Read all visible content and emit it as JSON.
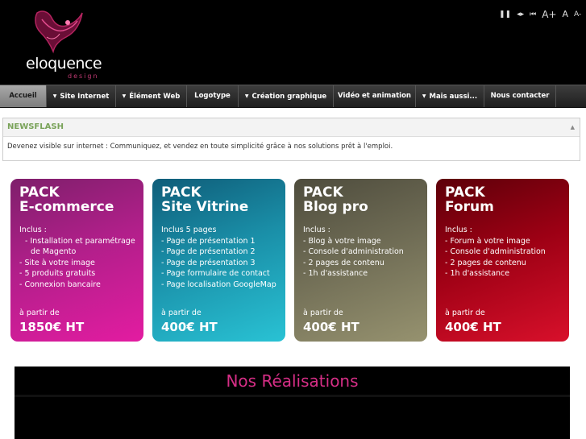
{
  "header": {
    "logo": {
      "name": "eloquence",
      "tagline": "design"
    },
    "controls": [
      {
        "icon": "pause-icon",
        "glyph": "❚❚"
      },
      {
        "icon": "prev-next-icon",
        "glyph": "◂▸"
      },
      {
        "icon": "rewind-icon",
        "glyph": "⏮"
      },
      {
        "label": "A+",
        "size": "big"
      },
      {
        "label": "A",
        "size": "mid"
      },
      {
        "label": "A-",
        "size": "small"
      }
    ]
  },
  "nav": [
    {
      "label": "Accueil",
      "active": true,
      "dropdown": false
    },
    {
      "label": "Site Internet",
      "active": false,
      "dropdown": true
    },
    {
      "label": "Élément Web",
      "active": false,
      "dropdown": true
    },
    {
      "label": "Logotype",
      "active": false,
      "dropdown": false
    },
    {
      "label": "Création graphique",
      "active": false,
      "dropdown": true
    },
    {
      "label": "Vidéo et animation",
      "active": false,
      "dropdown": false
    },
    {
      "label": "Mais aussi...",
      "active": false,
      "dropdown": true
    },
    {
      "label": "Nous contacter",
      "active": false,
      "dropdown": false
    }
  ],
  "newsflash": {
    "title": "NEWSFLASH",
    "text": "Devenez visible sur internet : Communiquez, et vendez en toute simplicité grâce à nos solutions prêt à l'emploi."
  },
  "packs": [
    {
      "title1": "PACK",
      "title2": "E-commerce",
      "incl": "Inclus :",
      "items": [
        "Installation et paramétrage de Magento",
        "Site à votre image",
        "5 produits gratuits",
        "Connexion bancaire"
      ],
      "from": "à partir de",
      "price": "1850€ HT",
      "color": "#c01e92"
    },
    {
      "title1": "PACK",
      "title2": "Site Vitrine",
      "incl": "Inclus 5 pages",
      "items": [
        "Page de présentation 1",
        "Page de présentation 2",
        "Page de présentation 3",
        "Page formulaire de contact",
        "Page localisation GoogleMap"
      ],
      "from": "à partir de",
      "price": "400€ HT",
      "color": "#1a8fa8"
    },
    {
      "title1": "PACK",
      "title2": "Blog pro",
      "incl": "Inclus :",
      "items": [
        "Blog à votre image",
        "Console d'administration",
        "2 pages de contenu",
        "1h d'assistance"
      ],
      "from": "à partir de",
      "price": "400€ HT",
      "color": "#6e6b54"
    },
    {
      "title1": "PACK",
      "title2": "Forum",
      "incl": "Inclus :",
      "items": [
        "Forum à votre image",
        "Console d'administration",
        "2 pages de contenu",
        "1h d'assistance"
      ],
      "from": "à partir de",
      "price": "400€ HT",
      "color": "#9c0014"
    }
  ],
  "realisations": {
    "title": "Nos Réalisations"
  },
  "colors": {
    "accent": "#d62e86",
    "newsflash": "#7aa35a"
  }
}
